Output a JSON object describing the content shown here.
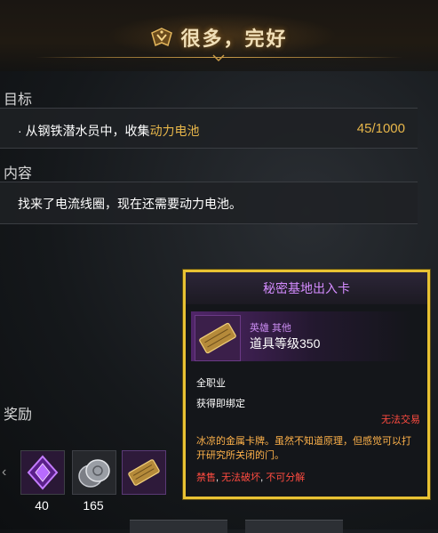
{
  "header": {
    "title": "很多，完好",
    "icon": "quest-emblem-icon",
    "accent_color": "#c99b48"
  },
  "objective": {
    "label": "目标",
    "bullet": "·",
    "text_prefix": "从钢铁潜水员中，收集",
    "text_highlight": "动力电池",
    "count": "45/1000",
    "highlight_color": "#e7b64a"
  },
  "content": {
    "label": "内容",
    "text": "找来了电流线圈，现在还需要动力电池。"
  },
  "rewards": {
    "label": "奖励",
    "nav_arrow": "‹",
    "items": [
      {
        "icon": "purple-crystal-icon",
        "count": "40"
      },
      {
        "icon": "silver-coins-icon",
        "count": "165"
      },
      {
        "icon": "gold-card-icon",
        "count": ""
      }
    ]
  },
  "tooltip": {
    "name": "秘密基地出入卡",
    "tags": "英雄 其他",
    "item_level": "道具等级350",
    "class_req": "全职业",
    "bind": "获得即绑定",
    "trade": "无法交易",
    "description": "冰凉的金属卡牌。虽然不知道原理，但感觉可以打开研究所关闭的门。",
    "footer": {
      "sell": "禁售",
      "destroy": "无法破坏",
      "disassemble": "不可分解"
    },
    "border_color": "#e9c233",
    "name_color": "#d48cff",
    "warn_color": "#ff4b40",
    "desc_color": "#ffb24a"
  }
}
